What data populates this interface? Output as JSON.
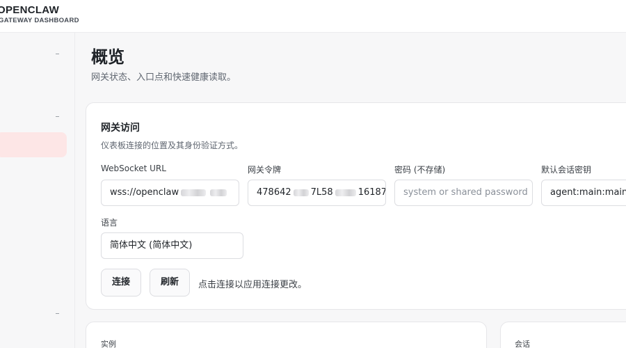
{
  "brand": {
    "title": "OPENCLAW",
    "subtitle": "GATEWAY DASHBOARD"
  },
  "page": {
    "title": "概览",
    "subtitle": "网关状态、入口点和快速健康读取。"
  },
  "gateway_access": {
    "title": "网关访问",
    "description": "仪表板连接的位置及其身份验证方式。",
    "fields": {
      "websocket_url": {
        "label": "WebSocket URL",
        "value_start": "wss://openclaw"
      },
      "gateway_token": {
        "label": "网关令牌",
        "value_start": "478642",
        "value_mid": "7L58",
        "value_end": "16187;"
      },
      "password": {
        "label": "密码 (不存储)",
        "placeholder": "system or shared password"
      },
      "session_key": {
        "label": "默认会话密钥",
        "value": "agent:main:main"
      },
      "language": {
        "label": "语言",
        "value": "简体中文 (简体中文)"
      }
    },
    "buttons": {
      "connect": "连接",
      "refresh": "刷新"
    },
    "hint": "点击连接以应用连接更改。"
  },
  "instance_card": {
    "title": "实例"
  },
  "session_card": {
    "title": "会话"
  }
}
